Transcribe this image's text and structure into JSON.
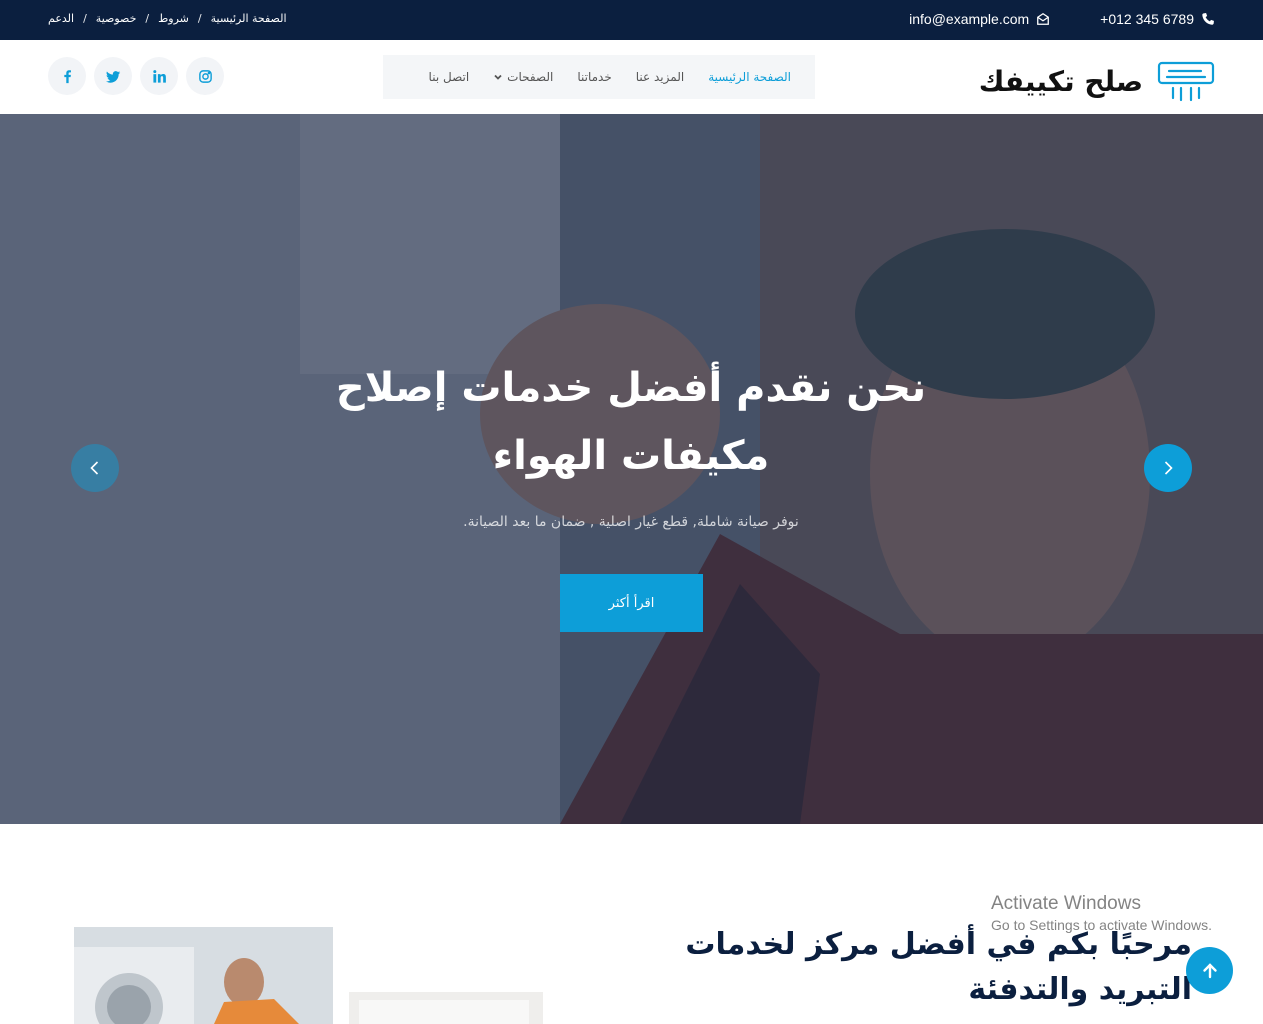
{
  "topbar": {
    "links": [
      "الصفحة الرئيسية",
      "شروط",
      "خصوصية",
      "الدعم"
    ],
    "phone": "+012 345 6789",
    "email": "info@example.com"
  },
  "brand": {
    "name": "صلح تكييفك"
  },
  "nav": {
    "items": [
      {
        "label": "الصفحة الرئيسية",
        "active": true
      },
      {
        "label": "المزيد عنا",
        "active": false
      },
      {
        "label": "خدماتنا",
        "active": false
      },
      {
        "label": "الصفحات",
        "active": false,
        "dropdown": true
      },
      {
        "label": "اتصل بنا",
        "active": false
      }
    ]
  },
  "social": [
    "facebook-icon",
    "twitter-icon",
    "linkedin-icon",
    "instagram-icon"
  ],
  "hero": {
    "title": "نحن نقدم أفضل خدمات إصلاح مكيفات الهواء",
    "subtitle": "نوفر صيانة شاملة, قطع غيار اصلية , ضمان ما بعد الصيانة.",
    "cta": "اقرأ أكثر"
  },
  "welcome": {
    "title": "مرحبًا بكم في أفضل مركز لخدمات التبريد والتدفئة"
  },
  "watermark": {
    "line1": "Activate Windows",
    "line2": "Go to Settings to activate Windows."
  },
  "colors": {
    "topbar": "#0b1f3f",
    "accent": "#0d9ed8",
    "heading": "#0b1f3f"
  }
}
